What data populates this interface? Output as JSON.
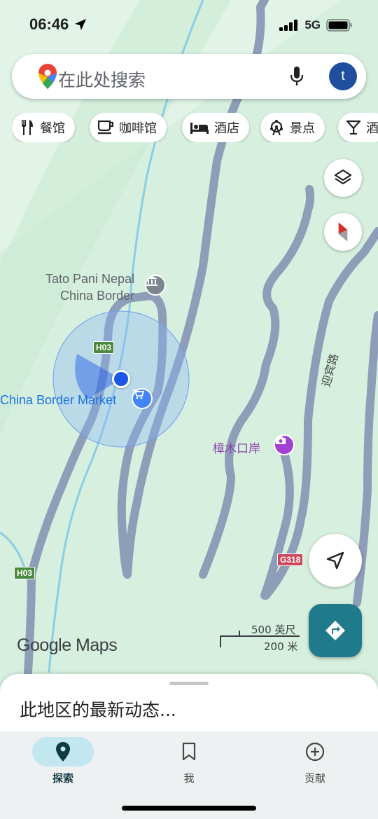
{
  "status_bar": {
    "time": "06:46",
    "network": "5G"
  },
  "search": {
    "placeholder": "在此处搜索",
    "avatar_letter": "t"
  },
  "chips": [
    {
      "label": "餐馆",
      "icon": "fork-knife-icon"
    },
    {
      "label": "咖啡馆",
      "icon": "coffee-cup-icon"
    },
    {
      "label": "酒店",
      "icon": "bed-icon"
    },
    {
      "label": "景点",
      "icon": "ferris-wheel-icon"
    },
    {
      "label": "酒",
      "icon": "cocktail-icon"
    }
  ],
  "map": {
    "places": [
      {
        "line1": "Tato Pani Nepal",
        "line2": "China Border",
        "icon": "landmark-icon"
      },
      {
        "name": "China Border Market",
        "icon": "shopping-cart-icon"
      },
      {
        "name": "樟木口岸",
        "icon": "camera-icon"
      }
    ],
    "road_labels": {
      "h03_top": "H03",
      "h03_left": "H03",
      "g318": "G318",
      "street": "迎宾路"
    },
    "scale": {
      "imperial": "500 英尺",
      "metric": "200 米"
    },
    "logo": "Google Maps"
  },
  "bottom_sheet": {
    "title": "此地区的最新动态..."
  },
  "nav": {
    "items": [
      {
        "label": "探索",
        "icon": "pin-icon",
        "active": true
      },
      {
        "label": "我",
        "icon": "bookmark-icon",
        "active": false
      },
      {
        "label": "贡献",
        "icon": "plus-circle-icon",
        "active": false
      }
    ]
  },
  "colors": {
    "map_background": "#d6efde",
    "road": "#8e9db8",
    "river": "#8ccde6",
    "location_dot": "#1a57e6",
    "directions_button": "#1f7a8c",
    "highway_badge": "#4a8a3c",
    "national_road_badge": "#d0475c"
  }
}
